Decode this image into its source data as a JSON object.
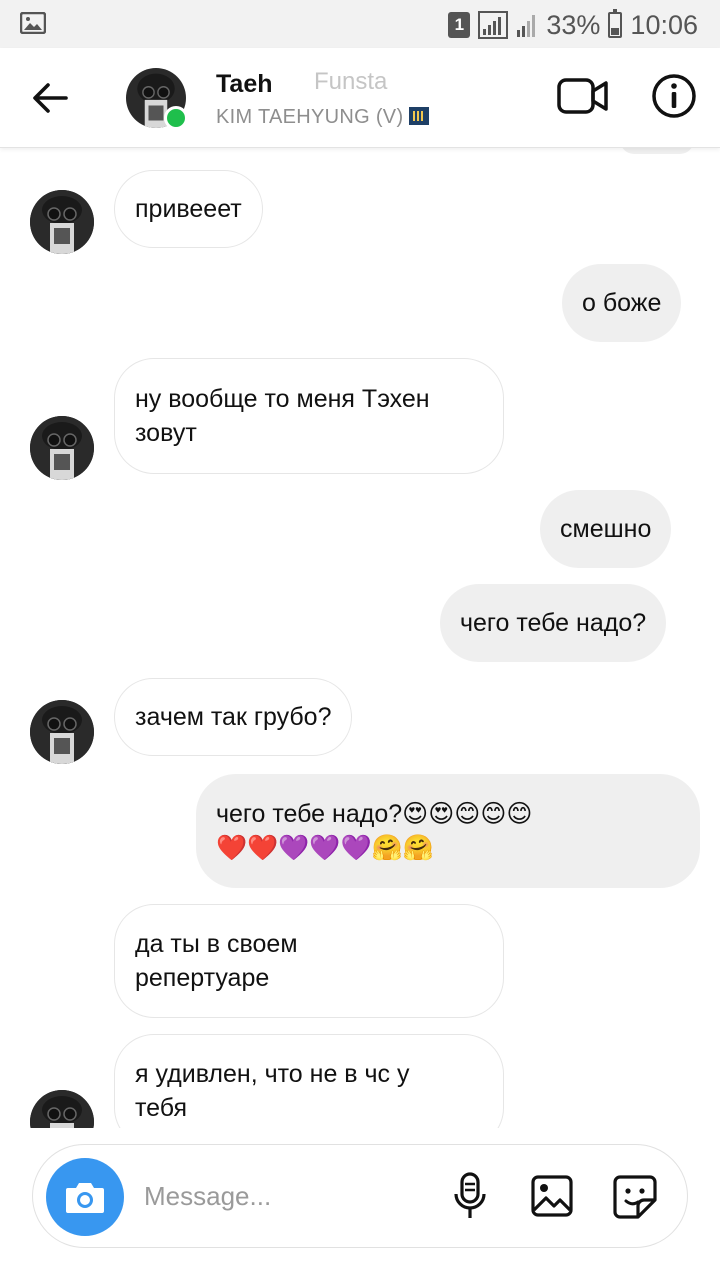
{
  "status_bar": {
    "sim": "1",
    "battery": "33%",
    "time": "10:06",
    "battery_fraction": 0.33
  },
  "header": {
    "name": "Taeh",
    "subtitle": "KIM TAEHYUNG (V)",
    "watermark": "Funsta"
  },
  "messages": [
    {
      "side": "in",
      "lines": [
        "привееет"
      ],
      "avatar": true
    },
    {
      "side": "out",
      "lines": [
        "о боже"
      ]
    },
    {
      "side": "in",
      "lines": [
        "ну вообще то меня Тэхен",
        "зовут"
      ],
      "avatar": true
    },
    {
      "side": "out",
      "lines": [
        "смешно"
      ]
    },
    {
      "side": "out",
      "lines": [
        "чего тебе надо?"
      ]
    },
    {
      "side": "in",
      "lines": [
        "зачем так грубо?"
      ],
      "avatar": true
    },
    {
      "side": "out",
      "lines": [
        "чего тебе надо?😍😍😊😊😊",
        "❤️❤️💜💜💜🤗🤗"
      ]
    },
    {
      "side": "in",
      "lines": [
        "да ты в своем",
        "репертуаре"
      ]
    },
    {
      "side": "in",
      "lines": [
        "я удивлен, что не в чс у",
        "тебя"
      ],
      "avatar": true
    }
  ],
  "composer": {
    "placeholder": "Message..."
  },
  "colors": {
    "accent": "#3897f0",
    "online": "#1fbf4c",
    "outgoing_bubble": "#efefef"
  },
  "icons": [
    "back-arrow-icon",
    "video-call-icon",
    "info-icon",
    "camera-icon",
    "microphone-icon",
    "gallery-icon",
    "sticker-icon"
  ]
}
